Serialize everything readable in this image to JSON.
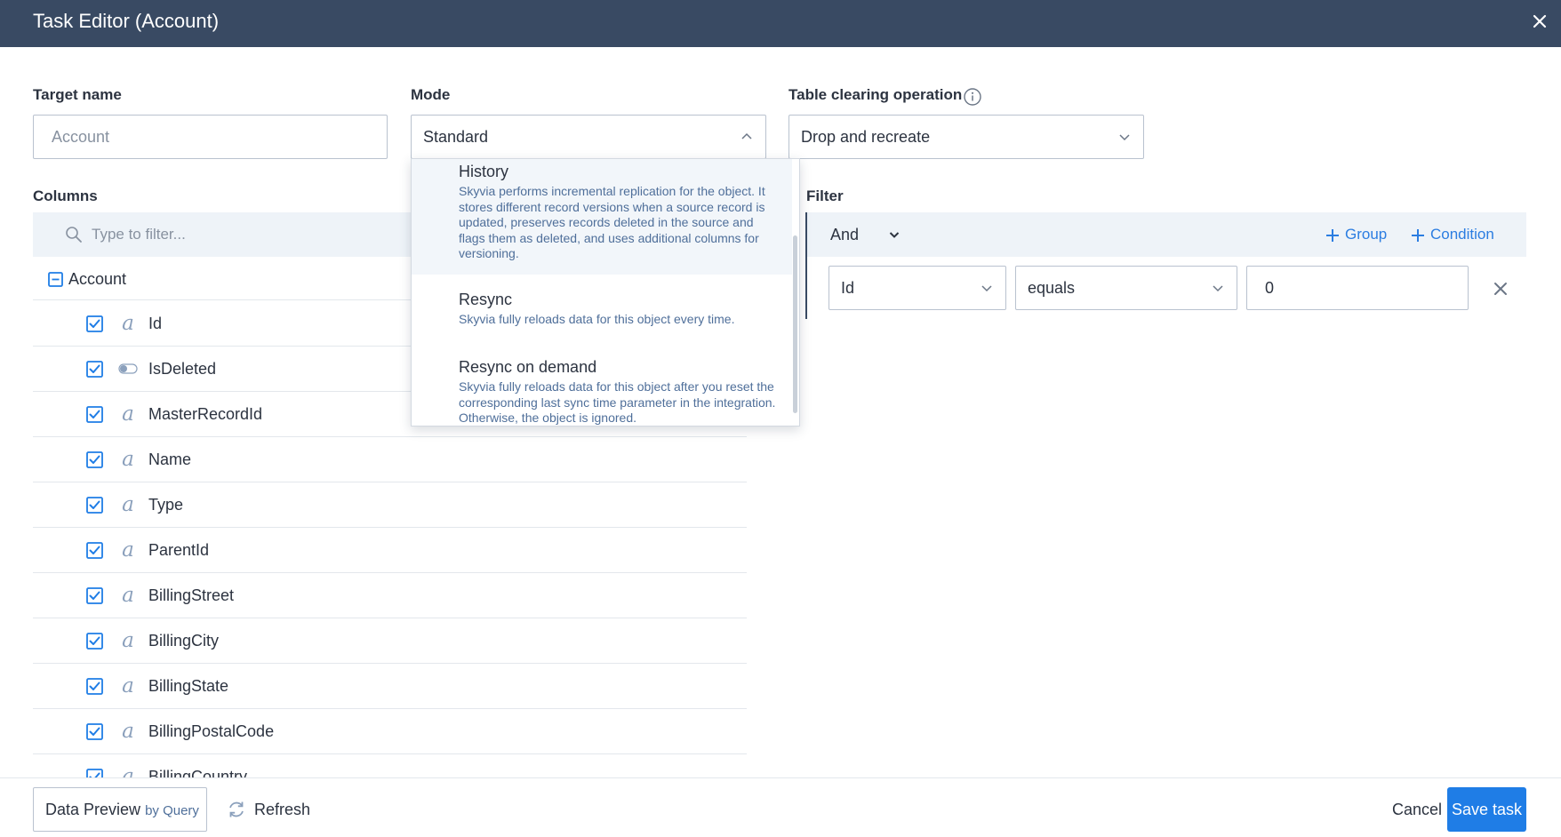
{
  "window": {
    "title": "Task Editor (Account)"
  },
  "target": {
    "label": "Target name",
    "placeholder": "Account"
  },
  "mode": {
    "label": "Mode",
    "value": "Standard",
    "options": [
      {
        "title": "History",
        "description": "Skyvia performs incremental replication for the object. It stores different record versions when a source record is updated, preserves records deleted in the source and flags them as deleted, and uses additional columns for versioning."
      },
      {
        "title": "Resync",
        "description": "Skyvia fully reloads data for this object every time."
      },
      {
        "title": "Resync on demand",
        "description": "Skyvia fully reloads data for this object after you reset the corresponding last sync time parameter in the integration. Otherwise, the object is ignored."
      }
    ]
  },
  "clearing": {
    "label": "Table clearing operation",
    "value": "Drop and recreate"
  },
  "columns": {
    "label": "Columns",
    "filter_placeholder": "Type to filter...",
    "group": "Account",
    "items": [
      {
        "name": "Id",
        "type": "string"
      },
      {
        "name": "IsDeleted",
        "type": "boolean"
      },
      {
        "name": "MasterRecordId",
        "type": "string"
      },
      {
        "name": "Name",
        "type": "string"
      },
      {
        "name": "Type",
        "type": "string"
      },
      {
        "name": "ParentId",
        "type": "string"
      },
      {
        "name": "BillingStreet",
        "type": "string"
      },
      {
        "name": "BillingCity",
        "type": "string"
      },
      {
        "name": "BillingState",
        "type": "string"
      },
      {
        "name": "BillingPostalCode",
        "type": "string"
      },
      {
        "name": "BillingCountry",
        "type": "string"
      }
    ]
  },
  "filter": {
    "label": "Filter",
    "operator": "And",
    "add_group": "Group",
    "add_condition": "Condition",
    "condition": {
      "field": "Id",
      "comparison": "equals",
      "value": "0"
    }
  },
  "footer": {
    "preview": "Data Preview",
    "preview_sub": "by Query",
    "refresh": "Refresh",
    "cancel": "Cancel",
    "save": "Save task"
  },
  "colors": {
    "header": "#394a63",
    "accent": "#1f7de6",
    "link": "#2b7de1"
  }
}
